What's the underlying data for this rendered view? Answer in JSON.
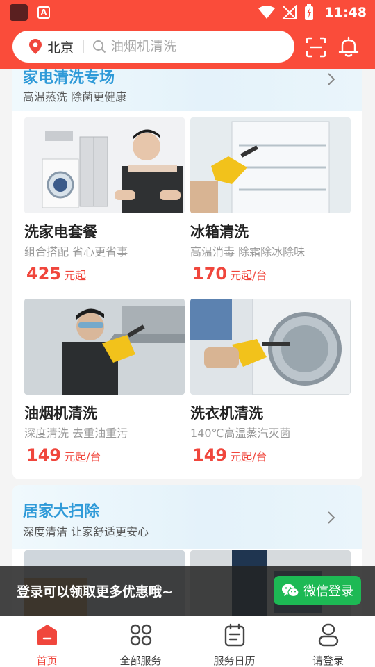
{
  "status_bar": {
    "time": "11:48",
    "notif_glyph": "A",
    "icons": [
      "app-icon",
      "notification-icon",
      "wifi-icon",
      "signal-icon",
      "battery-icon"
    ]
  },
  "header": {
    "city": "北京",
    "search_placeholder": "油烟机清洗",
    "icons": [
      "location-pin-icon",
      "search-icon",
      "scan-icon",
      "bell-icon"
    ]
  },
  "sections": [
    {
      "title": "家电清洗专场",
      "subtitle": "高温蒸洗 除菌更健康",
      "items": [
        {
          "title": "洗家电套餐",
          "desc": "组合搭配 省心更省事",
          "price": "425",
          "unit": "元起"
        },
        {
          "title": "冰箱清洗",
          "desc": "高温消毒 除霜除冰除味",
          "price": "170",
          "unit": "元起/台"
        },
        {
          "title": "油烟机清洗",
          "desc": "深度清洗  去重油重污",
          "price": "149",
          "unit": "元起/台"
        },
        {
          "title": "洗衣机清洗",
          "desc": "140℃高温蒸汽灭菌",
          "price": "149",
          "unit": "元起/台"
        }
      ]
    },
    {
      "title": "居家大扫除",
      "subtitle": "深度清洁 让家舒适更安心"
    }
  ],
  "login_bar": {
    "text": "登录可以领取更多优惠哦~",
    "button_label": "微信登录"
  },
  "tabbar": {
    "tabs": [
      {
        "label": "首页",
        "icon": "home-icon",
        "active": true
      },
      {
        "label": "全部服务",
        "icon": "grid-icon",
        "active": false
      },
      {
        "label": "服务日历",
        "icon": "calendar-icon",
        "active": false
      },
      {
        "label": "请登录",
        "icon": "user-icon",
        "active": false
      }
    ]
  },
  "colors": {
    "brand_red": "#fa4c3a",
    "price_red": "#f0463c",
    "section_title_blue": "#2f9ad8",
    "wechat_green": "#1db954"
  }
}
